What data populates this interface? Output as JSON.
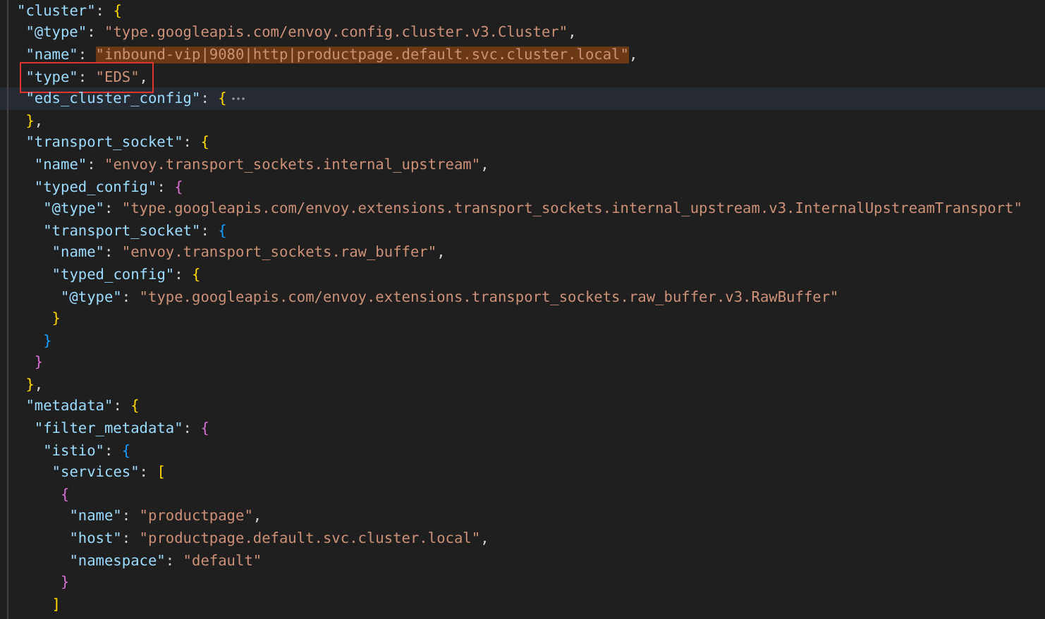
{
  "editor": {
    "lines": [
      {
        "tokens": [
          {
            "kind": "key",
            "text": "\"cluster\""
          },
          {
            "kind": "punct",
            "text": ": "
          },
          {
            "kind": "bracket",
            "text": "{",
            "color": "#ffd700"
          }
        ],
        "children": [
          {
            "tokens": [
              {
                "kind": "key",
                "text": "\"@type\""
              },
              {
                "kind": "punct",
                "text": ": "
              },
              {
                "kind": "string",
                "text": "\"type.googleapis.com/envoy.config.cluster.v3.Cluster\""
              },
              {
                "kind": "punct",
                "text": ","
              }
            ]
          },
          {
            "tokens": [
              {
                "kind": "key",
                "text": "\"name\""
              },
              {
                "kind": "punct",
                "text": ": "
              },
              {
                "kind": "string",
                "text": "\"inbound-vip|9080|http|productpage.default.svc.cluster.local\"",
                "highlighted": true
              },
              {
                "kind": "punct",
                "text": ","
              }
            ]
          },
          {
            "boxed": true,
            "tokens": [
              {
                "kind": "key",
                "text": "\"type\""
              },
              {
                "kind": "punct",
                "text": ": "
              },
              {
                "kind": "string",
                "text": "\"EDS\""
              },
              {
                "kind": "punct",
                "text": ","
              }
            ]
          },
          {
            "current": true,
            "folded": true,
            "tokens": [
              {
                "kind": "key",
                "text": "\"eds_cluster_config\""
              },
              {
                "kind": "punct",
                "text": ": "
              },
              {
                "kind": "bracket",
                "text": "{",
                "color": "#ffd700"
              }
            ]
          },
          {
            "tokens": [
              {
                "kind": "bracket",
                "text": "}",
                "color": "#ffd700"
              },
              {
                "kind": "punct",
                "text": ","
              }
            ]
          },
          {
            "tokens": [
              {
                "kind": "key",
                "text": "\"transport_socket\""
              },
              {
                "kind": "punct",
                "text": ": "
              },
              {
                "kind": "bracket",
                "text": "{",
                "color": "#ffd700"
              }
            ],
            "children": [
              {
                "tokens": [
                  {
                    "kind": "key",
                    "text": "\"name\""
                  },
                  {
                    "kind": "punct",
                    "text": ": "
                  },
                  {
                    "kind": "string",
                    "text": "\"envoy.transport_sockets.internal_upstream\""
                  },
                  {
                    "kind": "punct",
                    "text": ","
                  }
                ]
              },
              {
                "tokens": [
                  {
                    "kind": "key",
                    "text": "\"typed_config\""
                  },
                  {
                    "kind": "punct",
                    "text": ": "
                  },
                  {
                    "kind": "bracket",
                    "text": "{",
                    "color": "#da70d6"
                  }
                ],
                "children": [
                  {
                    "tokens": [
                      {
                        "kind": "key",
                        "text": "\"@type\""
                      },
                      {
                        "kind": "punct",
                        "text": ": "
                      },
                      {
                        "kind": "string",
                        "text": "\"type.googleapis.com/envoy.extensions.transport_sockets.internal_upstream.v3.InternalUpstreamTransport\""
                      }
                    ]
                  },
                  {
                    "tokens": [
                      {
                        "kind": "key",
                        "text": "\"transport_socket\""
                      },
                      {
                        "kind": "punct",
                        "text": ": "
                      },
                      {
                        "kind": "bracket",
                        "text": "{",
                        "color": "#179fff"
                      }
                    ],
                    "children": [
                      {
                        "tokens": [
                          {
                            "kind": "key",
                            "text": "\"name\""
                          },
                          {
                            "kind": "punct",
                            "text": ": "
                          },
                          {
                            "kind": "string",
                            "text": "\"envoy.transport_sockets.raw_buffer\""
                          },
                          {
                            "kind": "punct",
                            "text": ","
                          }
                        ]
                      },
                      {
                        "tokens": [
                          {
                            "kind": "key",
                            "text": "\"typed_config\""
                          },
                          {
                            "kind": "punct",
                            "text": ": "
                          },
                          {
                            "kind": "bracket",
                            "text": "{",
                            "color": "#ffd700"
                          }
                        ],
                        "children": [
                          {
                            "tokens": [
                              {
                                "kind": "key",
                                "text": "\"@type\""
                              },
                              {
                                "kind": "punct",
                                "text": ": "
                              },
                              {
                                "kind": "string",
                                "text": "\"type.googleapis.com/envoy.extensions.transport_sockets.raw_buffer.v3.RawBuffer\""
                              }
                            ]
                          }
                        ]
                      },
                      {
                        "tokens": [
                          {
                            "kind": "bracket",
                            "text": "}",
                            "color": "#ffd700"
                          }
                        ]
                      }
                    ]
                  },
                  {
                    "tokens": [
                      {
                        "kind": "bracket",
                        "text": "}",
                        "color": "#179fff"
                      }
                    ]
                  }
                ]
              },
              {
                "tokens": [
                  {
                    "kind": "bracket",
                    "text": "}",
                    "color": "#da70d6"
                  }
                ]
              }
            ]
          },
          {
            "tokens": [
              {
                "kind": "bracket",
                "text": "}",
                "color": "#ffd700"
              },
              {
                "kind": "punct",
                "text": ","
              }
            ]
          },
          {
            "tokens": [
              {
                "kind": "key",
                "text": "\"metadata\""
              },
              {
                "kind": "punct",
                "text": ": "
              },
              {
                "kind": "bracket",
                "text": "{",
                "color": "#ffd700"
              }
            ],
            "children": [
              {
                "tokens": [
                  {
                    "kind": "key",
                    "text": "\"filter_metadata\""
                  },
                  {
                    "kind": "punct",
                    "text": ": "
                  },
                  {
                    "kind": "bracket",
                    "text": "{",
                    "color": "#da70d6"
                  }
                ],
                "children": [
                  {
                    "tokens": [
                      {
                        "kind": "key",
                        "text": "\"istio\""
                      },
                      {
                        "kind": "punct",
                        "text": ": "
                      },
                      {
                        "kind": "bracket",
                        "text": "{",
                        "color": "#179fff"
                      }
                    ],
                    "children": [
                      {
                        "tokens": [
                          {
                            "kind": "key",
                            "text": "\"services\""
                          },
                          {
                            "kind": "punct",
                            "text": ": "
                          },
                          {
                            "kind": "bracket",
                            "text": "[",
                            "color": "#ffd700"
                          }
                        ],
                        "children": [
                          {
                            "tokens": [
                              {
                                "kind": "bracket",
                                "text": "{",
                                "color": "#da70d6"
                              }
                            ],
                            "children": [
                              {
                                "tokens": [
                                  {
                                    "kind": "key",
                                    "text": "\"name\""
                                  },
                                  {
                                    "kind": "punct",
                                    "text": ": "
                                  },
                                  {
                                    "kind": "string",
                                    "text": "\"productpage\""
                                  },
                                  {
                                    "kind": "punct",
                                    "text": ","
                                  }
                                ]
                              },
                              {
                                "tokens": [
                                  {
                                    "kind": "key",
                                    "text": "\"host\""
                                  },
                                  {
                                    "kind": "punct",
                                    "text": ": "
                                  },
                                  {
                                    "kind": "string",
                                    "text": "\"productpage.default.svc.cluster.local\""
                                  },
                                  {
                                    "kind": "punct",
                                    "text": ","
                                  }
                                ]
                              },
                              {
                                "tokens": [
                                  {
                                    "kind": "key",
                                    "text": "\"namespace\""
                                  },
                                  {
                                    "kind": "punct",
                                    "text": ": "
                                  },
                                  {
                                    "kind": "string",
                                    "text": "\"default\""
                                  }
                                ]
                              }
                            ]
                          },
                          {
                            "tokens": [
                              {
                                "kind": "bracket",
                                "text": "}",
                                "color": "#da70d6"
                              }
                            ]
                          }
                        ]
                      },
                      {
                        "tokens": [
                          {
                            "kind": "bracket",
                            "text": "]",
                            "color": "#ffd700"
                          }
                        ]
                      }
                    ]
                  }
                ]
              }
            ]
          }
        ]
      }
    ]
  }
}
